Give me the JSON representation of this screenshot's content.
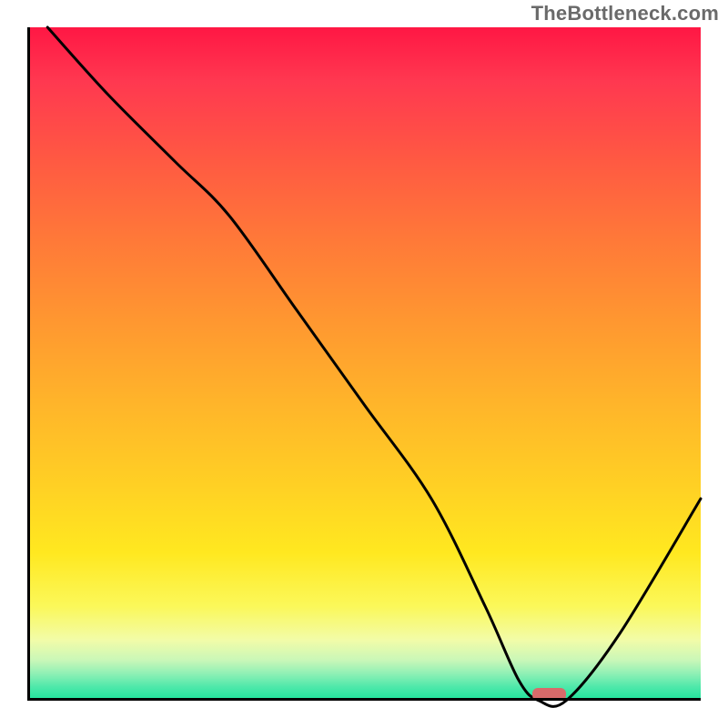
{
  "watermark": "TheBottleneck.com",
  "chart_data": {
    "type": "line",
    "title": "",
    "xlabel": "",
    "ylabel": "",
    "xlim": [
      0,
      100
    ],
    "ylim": [
      0,
      100
    ],
    "grid": false,
    "series": [
      {
        "name": "curve",
        "x": [
          3,
          12,
          22,
          30,
          40,
          50,
          60,
          68,
          73,
          76,
          80,
          88,
          100
        ],
        "values": [
          100,
          90,
          80,
          72,
          58,
          44,
          30,
          14,
          3,
          0,
          0,
          10,
          30
        ]
      }
    ],
    "marker": {
      "x_start": 75,
      "x_end": 80,
      "y": 0
    },
    "gradient_stops": [
      {
        "pct": 0,
        "color": "#ff1744"
      },
      {
        "pct": 20,
        "color": "#ff5a42"
      },
      {
        "pct": 44,
        "color": "#ff9830"
      },
      {
        "pct": 68,
        "color": "#ffd024"
      },
      {
        "pct": 86,
        "color": "#fbf85a"
      },
      {
        "pct": 96,
        "color": "#8ef0b5"
      },
      {
        "pct": 100,
        "color": "#1ce29a"
      }
    ]
  }
}
